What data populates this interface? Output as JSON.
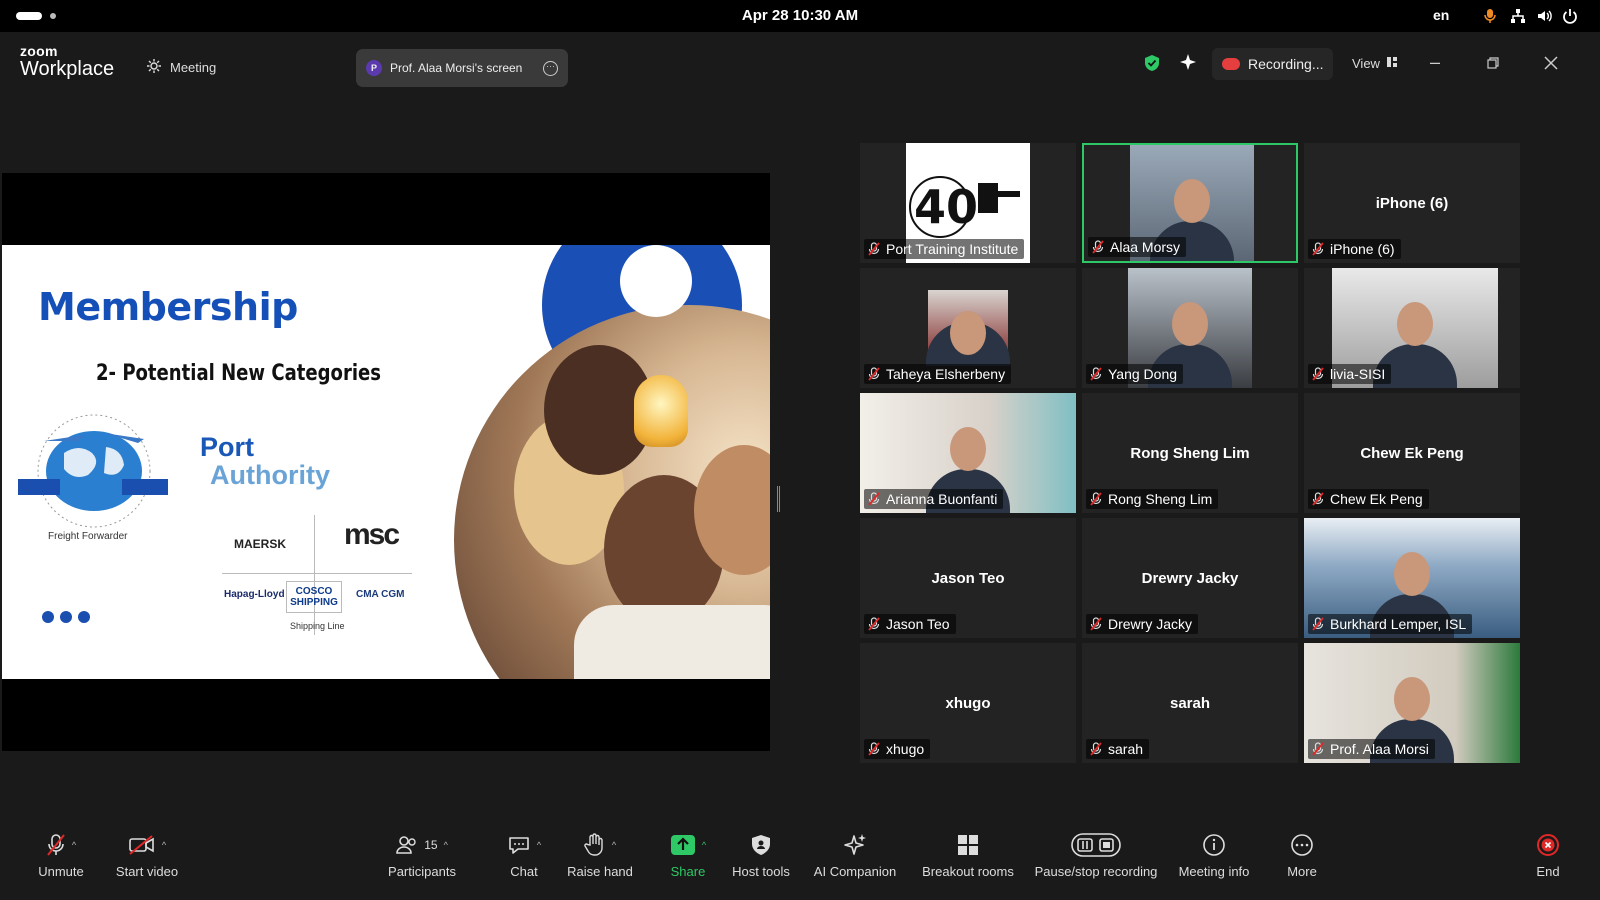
{
  "os": {
    "clock": "Apr 28  10:30 AM",
    "lang": "en"
  },
  "titlebar": {
    "logo_top": "zoom",
    "logo_bottom": "Workplace",
    "meeting_tab": "Meeting",
    "screen_pill_initial": "P",
    "screen_pill_label": "Prof. Alaa Morsi's screen",
    "recording_label": "Recording...",
    "view_label": "View"
  },
  "slide": {
    "title": "Membership",
    "subtitle": "2- Potential New Categories",
    "port_authority_line1": "Port",
    "port_authority_line2": "Authority",
    "freight_label": "Freight Forwarder",
    "shipping_label": "Shipping Line",
    "carriers": [
      "MAERSK",
      "msc",
      "Hapag-Lloyd",
      "COSCO SHIPPING",
      "CMA CGM"
    ]
  },
  "gallery": [
    {
      "name": "Port Training Institute",
      "center": "",
      "video": "logo"
    },
    {
      "name": "Alaa Morsy",
      "center": "",
      "video": "person"
    },
    {
      "name": "iPhone (6)",
      "center": "iPhone (6)",
      "video": "none"
    },
    {
      "name": "Taheya Elsherbeny",
      "center": "",
      "video": "person"
    },
    {
      "name": "Yang Dong",
      "center": "",
      "video": "person"
    },
    {
      "name": "livia-SISI",
      "center": "",
      "video": "person"
    },
    {
      "name": "Arianna Buonfanti",
      "center": "",
      "video": "person"
    },
    {
      "name": "Rong Sheng Lim",
      "center": "Rong Sheng Lim",
      "video": "none"
    },
    {
      "name": "Chew Ek Peng",
      "center": "Chew Ek Peng",
      "video": "none"
    },
    {
      "name": "Jason Teo",
      "center": "Jason Teo",
      "video": "none"
    },
    {
      "name": "Drewry Jacky",
      "center": "Drewry Jacky",
      "video": "none"
    },
    {
      "name": "Burkhard Lemper, ISL",
      "center": "",
      "video": "person"
    },
    {
      "name": "xhugo",
      "center": "xhugo",
      "video": "none"
    },
    {
      "name": "sarah",
      "center": "sarah",
      "video": "none"
    },
    {
      "name": "Prof. Alaa Morsi",
      "center": "",
      "video": "person"
    }
  ],
  "toolbar": {
    "unmute": "Unmute",
    "start_video": "Start video",
    "participants": "Participants",
    "participants_count": "15",
    "chat": "Chat",
    "raise_hand": "Raise hand",
    "share": "Share",
    "host_tools": "Host tools",
    "ai_companion": "AI Companion",
    "breakout_rooms": "Breakout rooms",
    "pause_recording": "Pause/stop recording",
    "meeting_info": "Meeting info",
    "more": "More",
    "end": "End"
  },
  "colors": {
    "accent_green": "#2ec866",
    "end_red": "#e02828",
    "slide_blue": "#1550b8"
  }
}
